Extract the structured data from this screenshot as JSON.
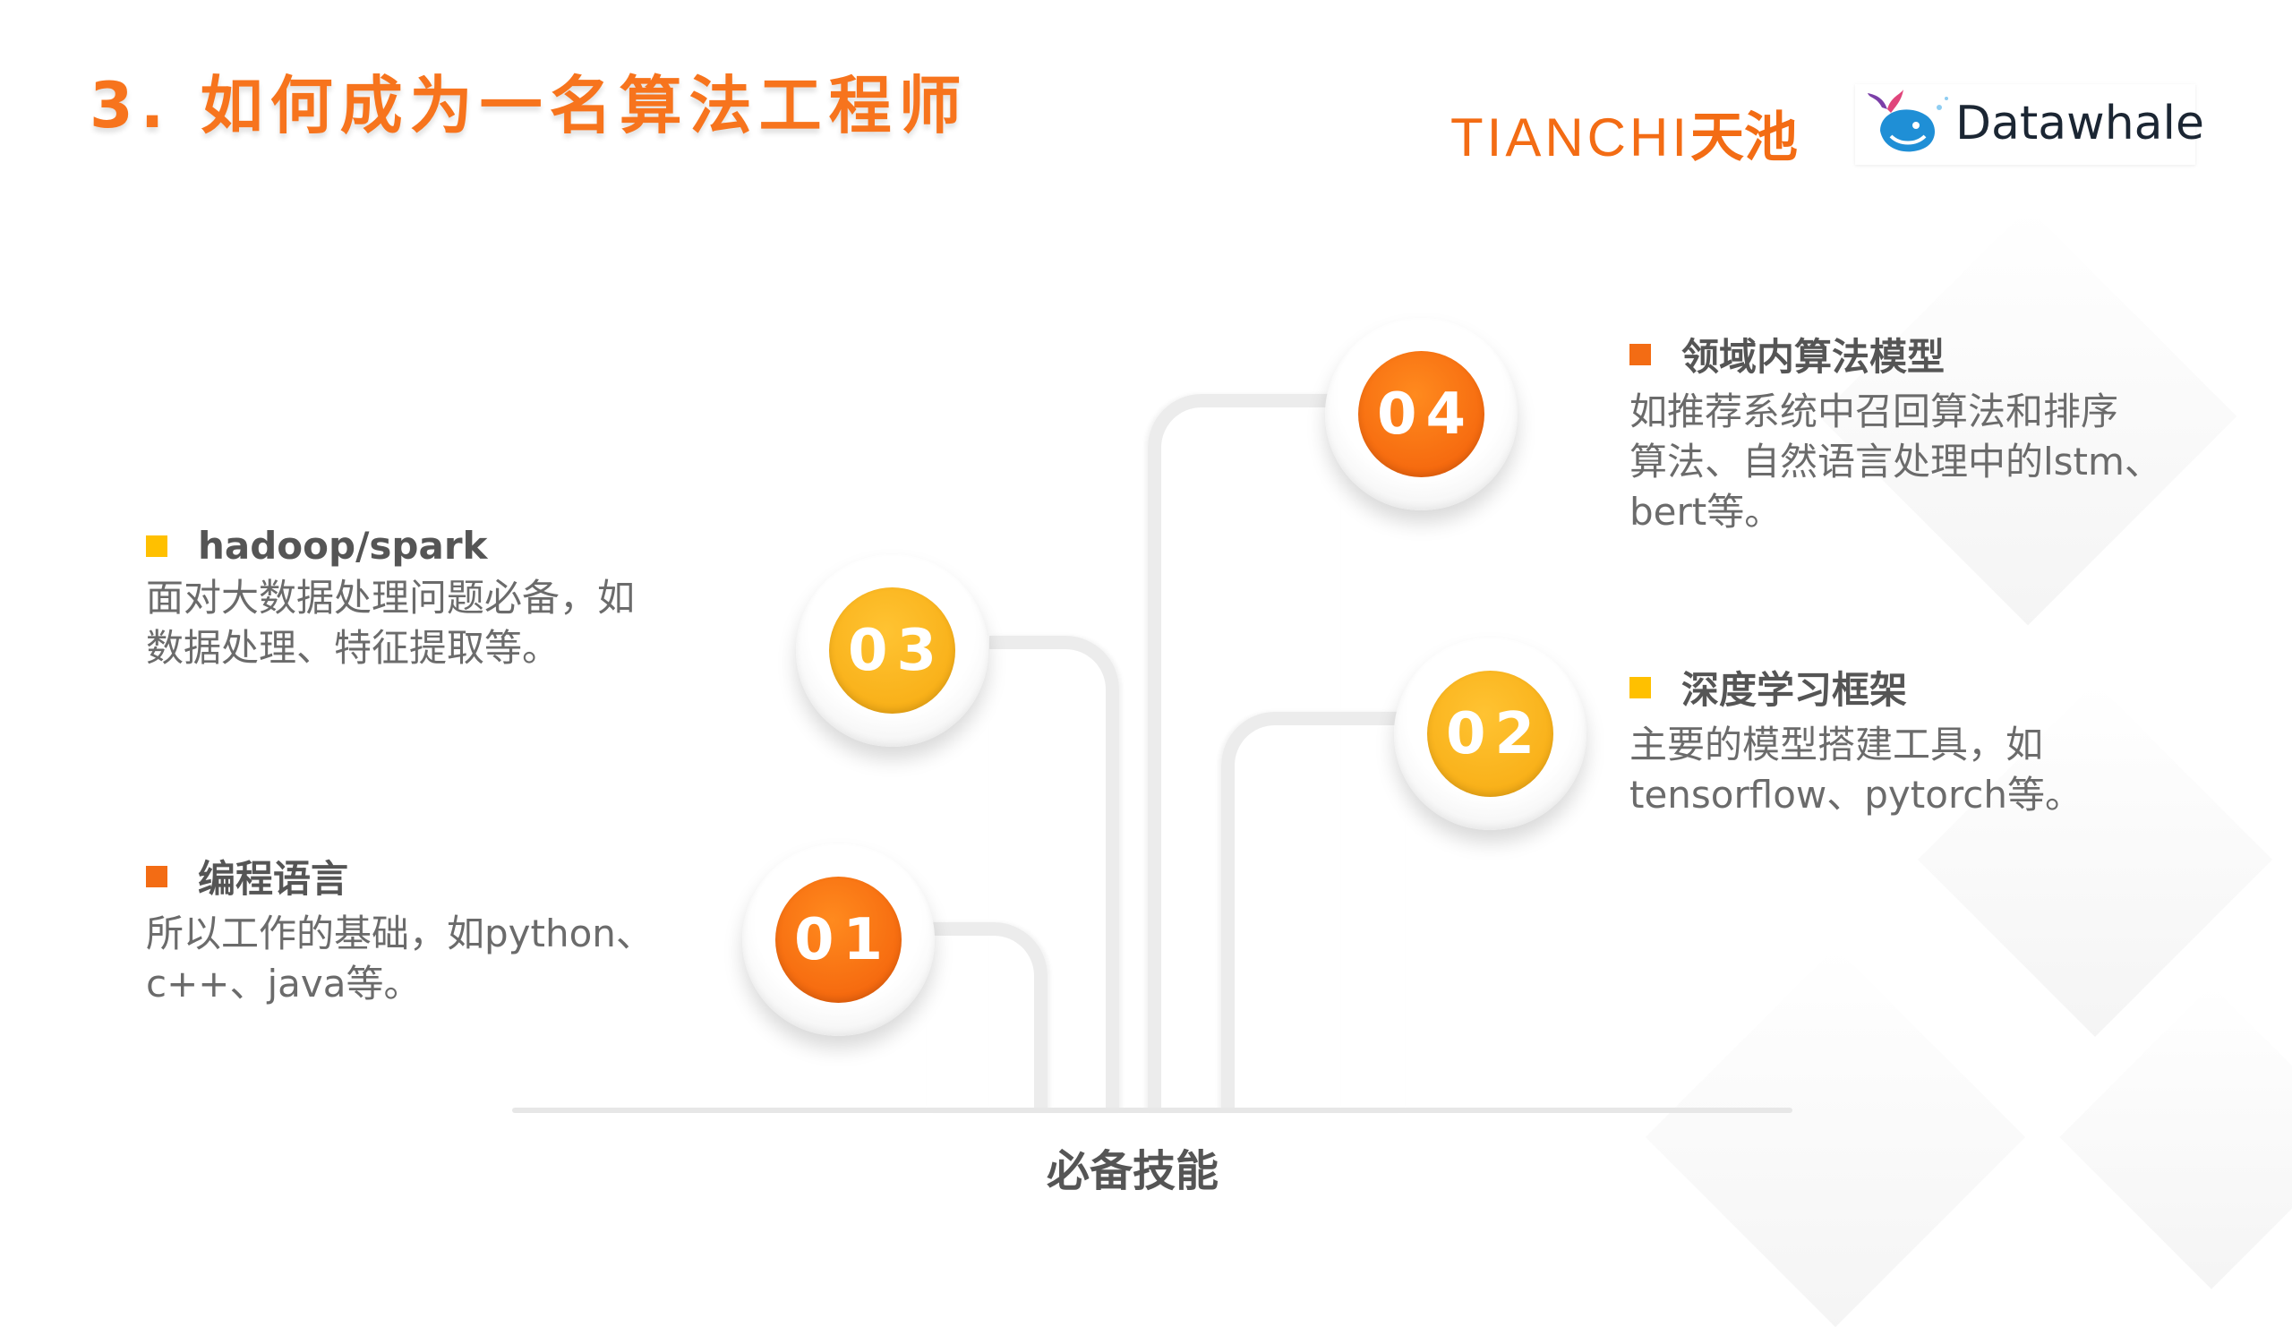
{
  "title": "3. 如何成为一名算法工程师",
  "logos": {
    "tianchi_latin": "TIANCHI",
    "tianchi_cn": "天池",
    "datawhale": "Datawhale"
  },
  "axis_label": "必备技能",
  "steps": [
    {
      "number": "01",
      "heading": "编程语言",
      "lines": [
        "所以工作的基础，如python、",
        "c++、java等。"
      ]
    },
    {
      "number": "02",
      "heading": "深度学习框架",
      "lines": [
        "主要的模型搭建工具，如",
        "tensorflow、pytorch等。"
      ]
    },
    {
      "number": "03",
      "heading": "hadoop/spark",
      "lines": [
        "面对大数据处理问题必备，如",
        "数据处理、特征提取等。"
      ]
    },
    {
      "number": "04",
      "heading": "领域内算法模型",
      "lines": [
        "如推荐系统中召回算法和排序",
        "算法、自然语言处理中的lstm、",
        "bert等。"
      ]
    }
  ],
  "colors": {
    "accent_orange": "#f36c14",
    "accent_yellow": "#ffc000"
  }
}
